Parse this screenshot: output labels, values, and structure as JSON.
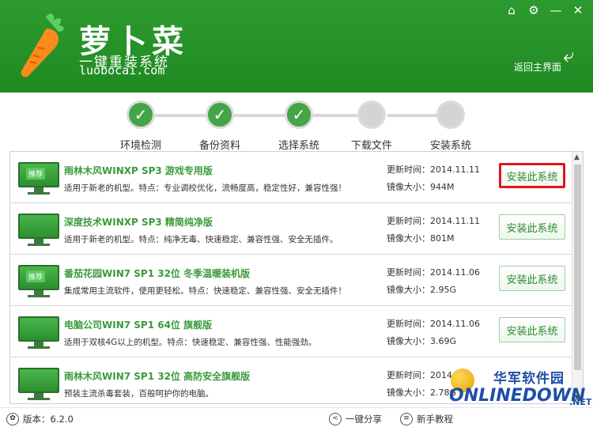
{
  "header": {
    "brand_title": "萝卜菜",
    "brand_subtitle": "一键重装系统",
    "brand_url": "luobocai.com",
    "back_home_label": "返回主界面",
    "icons": [
      "home-icon",
      "gear-icon",
      "minimize-icon",
      "close-icon"
    ],
    "icon_glyphs": {
      "home": "⌂",
      "settings": "⚙",
      "minimize": "—",
      "close": "✕"
    }
  },
  "steps": [
    {
      "label": "环境检测",
      "status": "done"
    },
    {
      "label": "备份资料",
      "status": "done"
    },
    {
      "label": "选择系统",
      "status": "done"
    },
    {
      "label": "下载文件",
      "status": "todo"
    },
    {
      "label": "安装系统",
      "status": "todo"
    }
  ],
  "check_glyph": "✓",
  "update_label": "更新时间：",
  "size_label": "镜像大小：",
  "install_label": "安装此系统",
  "recommend_tag": "推荐",
  "systems": [
    {
      "title": "雨林木风WINXP SP3 游戏专用版",
      "desc": "适用于新老的机型。特点：专业调校优化，流畅度高，稳定性好，兼容性强！",
      "update": "2014.11.11",
      "size": "944M",
      "recommended": true,
      "highlighted": true
    },
    {
      "title": "深度技术WINXP SP3 精简纯净版",
      "desc": "适用于新老的机型。特点：纯净无毒、快速稳定、兼容性强、安全无插件。",
      "update": "2014.11.11",
      "size": "801M",
      "recommended": false,
      "highlighted": false
    },
    {
      "title": "番茄花园WIN7 SP1 32位 冬季温暖装机版",
      "desc": "集成常用主流软件，使用更轻松。特点：快速稳定、兼容性强、安全无插件！",
      "update": "2014.11.06",
      "size": "2.95G",
      "recommended": true,
      "highlighted": false
    },
    {
      "title": "电脑公司WIN7 SP1 64位 旗舰版",
      "desc": "适用于双核4G以上的机型。特点：快速稳定、兼容性强、性能强劲。",
      "update": "2014.11.06",
      "size": "3.69G",
      "recommended": false,
      "highlighted": false
    },
    {
      "title": "雨林木风WIN7 SP1 32位 高防安全旗舰版",
      "desc": "预装主流杀毒套装，百般呵护你的电脑。",
      "update": "2014",
      "size": "2.78G",
      "recommended": false,
      "highlighted": false
    }
  ],
  "footer": {
    "version": "版本：6.2.0",
    "share": "一键分享",
    "tutorial": "新手教程"
  },
  "watermark": {
    "cn": "华军软件园",
    "en": "ONLINEDOWN",
    "suffix": ".NET"
  }
}
